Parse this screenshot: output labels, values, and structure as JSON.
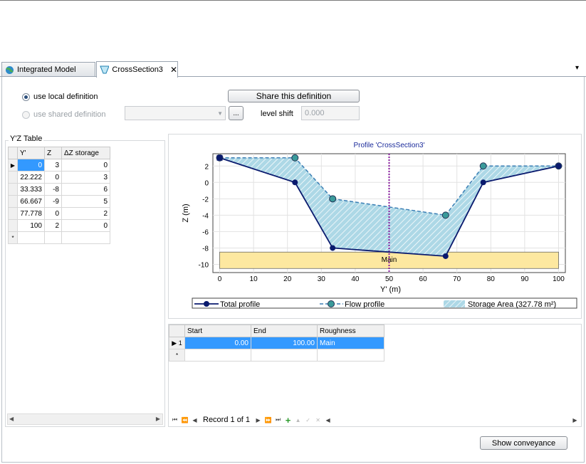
{
  "tabs": [
    {
      "label": "Integrated Model",
      "icon": "globe-icon"
    },
    {
      "label": "CrossSection3",
      "icon": "cross-section-icon",
      "close": "✕"
    }
  ],
  "tab_menu_glyph": "▾",
  "definition": {
    "local_label": "use local definition",
    "shared_label": "use shared definition",
    "share_button": "Share this definition",
    "browse_button": "...",
    "level_shift_label": "level shift",
    "level_shift_value": "0.000"
  },
  "yz_table": {
    "title": "Y'Z Table",
    "headers": [
      "Y'",
      "Z",
      "ΔZ storage"
    ],
    "rows": [
      [
        "0",
        "3",
        "0"
      ],
      [
        "22.222",
        "0",
        "3"
      ],
      [
        "33.333",
        "-8",
        "6"
      ],
      [
        "66.667",
        "-9",
        "5"
      ],
      [
        "77.778",
        "0",
        "2"
      ],
      [
        "100",
        "2",
        "0"
      ]
    ],
    "current_marker": "▶",
    "new_marker": "*"
  },
  "chart_data": {
    "type": "line",
    "title": "Profile 'CrossSection3'",
    "xlabel": "Y'  (m)",
    "ylabel": "Z (m)",
    "xlim": [
      -2,
      102
    ],
    "ylim": [
      -11,
      3.5
    ],
    "xticks": [
      0,
      10,
      20,
      30,
      40,
      50,
      60,
      70,
      80,
      90,
      100
    ],
    "yticks": [
      2,
      0,
      -2,
      -4,
      -6,
      -8,
      -10
    ],
    "series": [
      {
        "name": "Total profile",
        "x": [
          0,
          22.222,
          33.333,
          66.667,
          77.778,
          100
        ],
        "y": [
          3,
          0,
          -8,
          -9,
          0,
          2
        ],
        "color": "#0a1a6e"
      },
      {
        "name": "Flow profile",
        "x": [
          0,
          22.222,
          33.333,
          66.667,
          77.778,
          100
        ],
        "y": [
          3,
          3,
          -2,
          -4,
          2,
          2
        ],
        "color": "#3b7fb5"
      }
    ],
    "storage_area_label": "Storage Area (327.78 m²)",
    "storage_fill": "#add8e6",
    "main_section": {
      "label": "Main",
      "x0": 0,
      "x1": 100,
      "ytop": -8.5,
      "ybottom": -10.5,
      "color": "#fde8a0"
    },
    "marker_line_x": 50,
    "marker_color": "#8a1aa0",
    "grid": true
  },
  "roughness": {
    "headers": [
      "Start",
      "End",
      "Roughness"
    ],
    "rows": [
      {
        "marker": "▶ 1",
        "start": "0.00",
        "end": "100.00",
        "roughness": "Main"
      }
    ],
    "new_marker": "*"
  },
  "navigator": {
    "record_text": "Record 1 of 1"
  },
  "show_conveyance": "Show conveyance"
}
